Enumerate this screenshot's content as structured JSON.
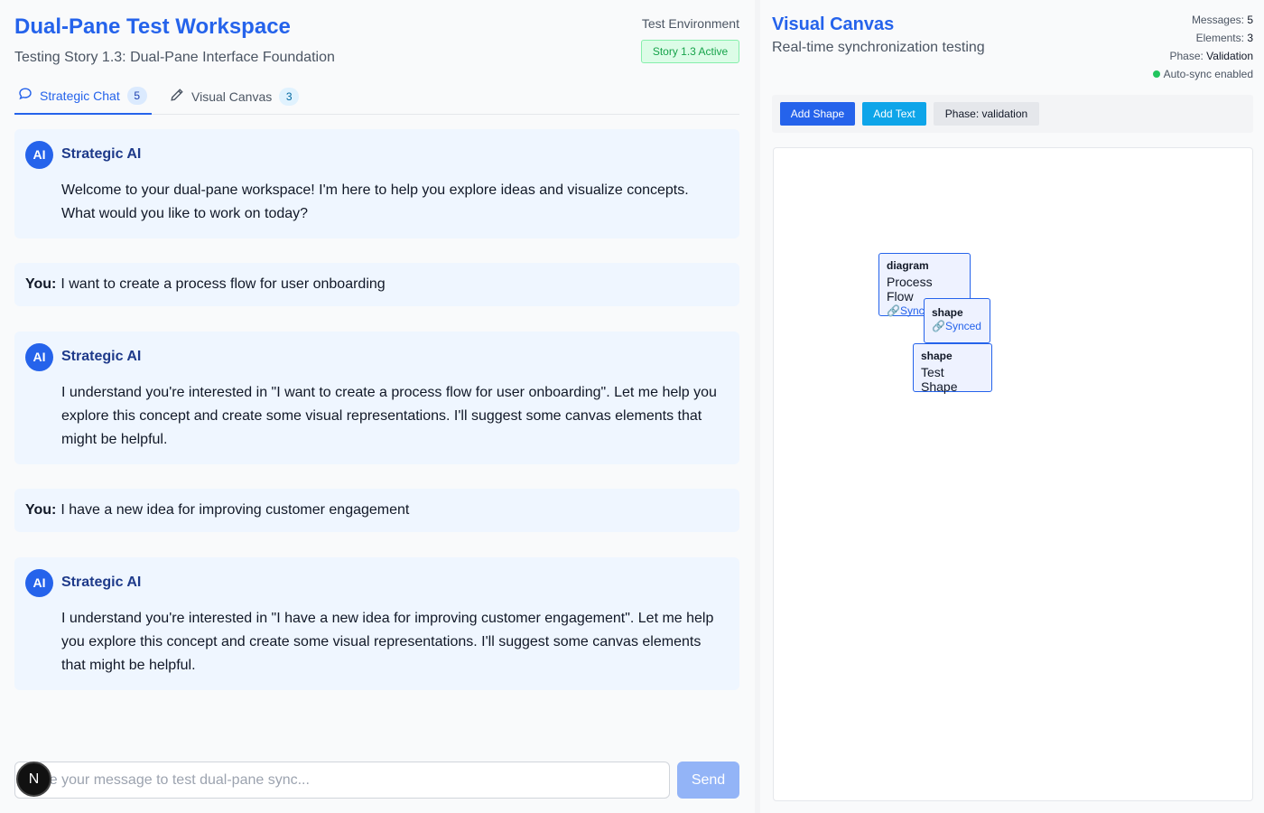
{
  "header": {
    "title": "Dual-Pane Test Workspace",
    "subtitle": "Testing Story 1.3: Dual-Pane Interface Foundation",
    "environment": "Test Environment",
    "story_badge": "Story 1.3 Active"
  },
  "tabs": [
    {
      "label": "Strategic Chat",
      "count": "5",
      "icon": "chat-bubble-icon",
      "active": true
    },
    {
      "label": "Visual Canvas",
      "count": "3",
      "icon": "pencil-icon",
      "active": false
    }
  ],
  "messages": [
    {
      "role": "ai",
      "avatar": "AI",
      "sender": "Strategic AI",
      "text": "Welcome to your dual-pane workspace! I'm here to help you explore ideas and visualize concepts. What would you like to work on today?"
    },
    {
      "role": "user",
      "sender": "You:",
      "text": "I want to create a process flow for user onboarding"
    },
    {
      "role": "ai",
      "avatar": "AI",
      "sender": "Strategic AI",
      "text": "I understand you're interested in \"I want to create a process flow for user onboarding\". Let me help you explore this concept and create some visual representations. I'll suggest some canvas elements that might be helpful."
    },
    {
      "role": "user",
      "sender": "You:",
      "text": "I have a new idea for improving customer engagement"
    },
    {
      "role": "ai",
      "avatar": "AI",
      "sender": "Strategic AI",
      "text": "I understand you're interested in \"I have a new idea for improving customer engagement\". Let me help you explore this concept and create some visual representations. I'll suggest some canvas elements that might be helpful."
    }
  ],
  "input": {
    "placeholder": "Type your message to test dual-pane sync...",
    "send_label": "Send"
  },
  "fab": {
    "label": "N"
  },
  "canvas": {
    "title": "Visual Canvas",
    "subtitle": "Real-time synchronization testing",
    "stats": {
      "messages_label": "Messages:",
      "messages_value": "5",
      "elements_label": "Elements:",
      "elements_value": "3",
      "phase_label": "Phase:",
      "phase_value": "Validation",
      "autosync": "Auto-sync enabled"
    },
    "toolbar": {
      "add_shape": "Add Shape",
      "add_text": "Add Text",
      "phase": "Phase: validation"
    },
    "elements": [
      {
        "type": "diagram",
        "label": "Process Flow",
        "sync": "🔗Synced"
      },
      {
        "type": "shape",
        "label": "",
        "sync": "🔗Synced"
      },
      {
        "type": "shape",
        "label": "Test Shape",
        "sync": ""
      }
    ]
  },
  "colors": {
    "accent": "#2563eb",
    "accent_light": "#0ea5e9",
    "success": "#22c55e",
    "message_bg": "#eff6ff"
  }
}
